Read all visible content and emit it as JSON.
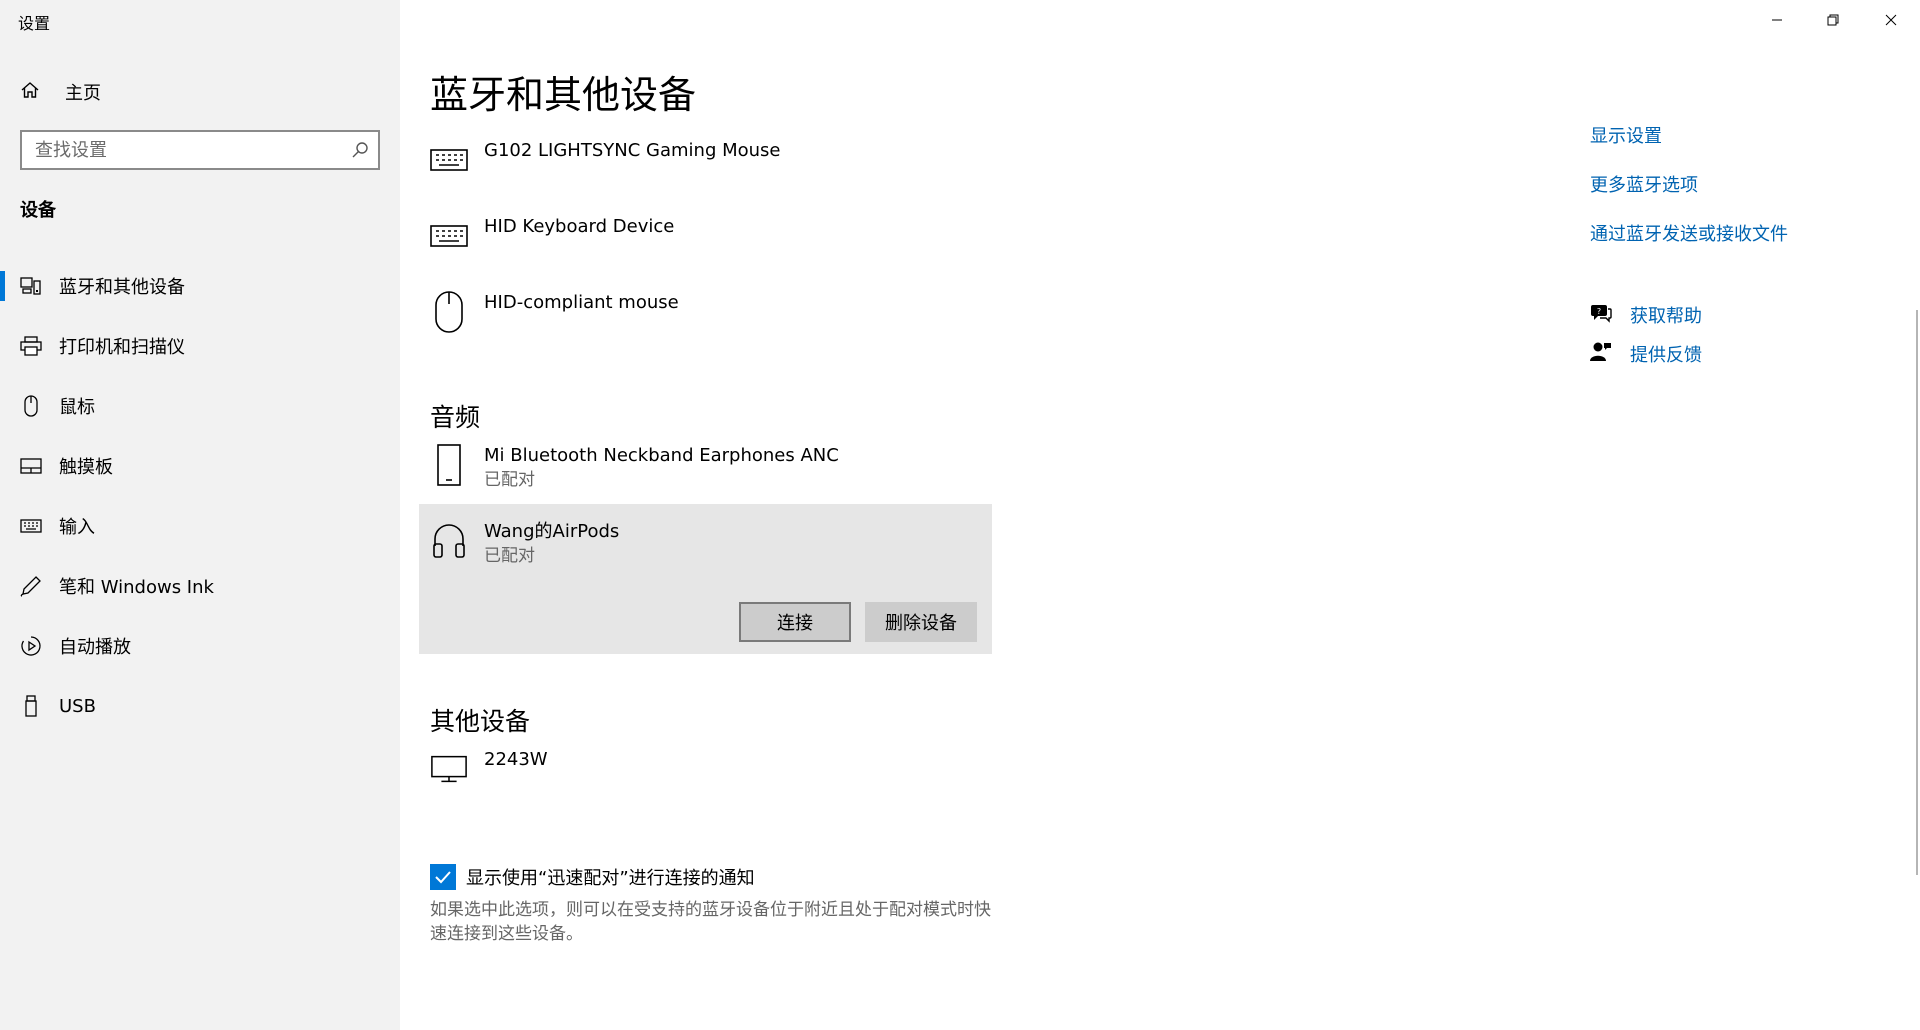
{
  "app": {
    "title": "设置"
  },
  "sidebar": {
    "home_label": "主页",
    "search_placeholder": "查找设置",
    "section_heading": "设备",
    "items": [
      {
        "label": "蓝牙和其他设备",
        "icon": "bluetooth-devices-icon",
        "active": true
      },
      {
        "label": "打印机和扫描仪",
        "icon": "printer-icon"
      },
      {
        "label": "鼠标",
        "icon": "mouse-icon"
      },
      {
        "label": "触摸板",
        "icon": "touchpad-icon"
      },
      {
        "label": "输入",
        "icon": "keyboard-icon"
      },
      {
        "label": "笔和 Windows Ink",
        "icon": "pen-icon"
      },
      {
        "label": "自动播放",
        "icon": "autoplay-icon"
      },
      {
        "label": "USB",
        "icon": "usb-icon"
      }
    ]
  },
  "main": {
    "title": "蓝牙和其他设备",
    "input_devices": [
      {
        "name": "G102 LIGHTSYNC Gaming Mouse",
        "icon": "keyboard-icon"
      },
      {
        "name": "HID Keyboard Device",
        "icon": "keyboard-icon"
      },
      {
        "name": "HID-compliant mouse",
        "icon": "mouse-icon"
      }
    ],
    "audio": {
      "heading": "音频",
      "devices": [
        {
          "name": "Mi Bluetooth Neckband Earphones ANC",
          "status": "已配对",
          "icon": "phone-icon"
        },
        {
          "name": "Wang的AirPods",
          "status": "已配对",
          "icon": "headphones-icon",
          "selected": true
        }
      ],
      "connect_label": "连接",
      "remove_label": "删除设备"
    },
    "other": {
      "heading": "其他设备",
      "devices": [
        {
          "name": "2243W",
          "icon": "monitor-icon"
        }
      ]
    },
    "swift_pair": {
      "label": "显示使用“迅速配对”进行连接的通知",
      "checked": true,
      "description": "如果选中此选项，则可以在受支持的蓝牙设备位于附近且处于配对模式时快速连接到这些设备。"
    }
  },
  "related": {
    "links": [
      "显示设置",
      "更多蓝牙选项",
      "通过蓝牙发送或接收文件"
    ],
    "help_label": "获取帮助",
    "feedback_label": "提供反馈"
  },
  "colors": {
    "accent": "#0078d7",
    "link": "#0063b1",
    "sidebar_bg": "#f2f2f2",
    "selected_bg": "#e6e6e6"
  }
}
